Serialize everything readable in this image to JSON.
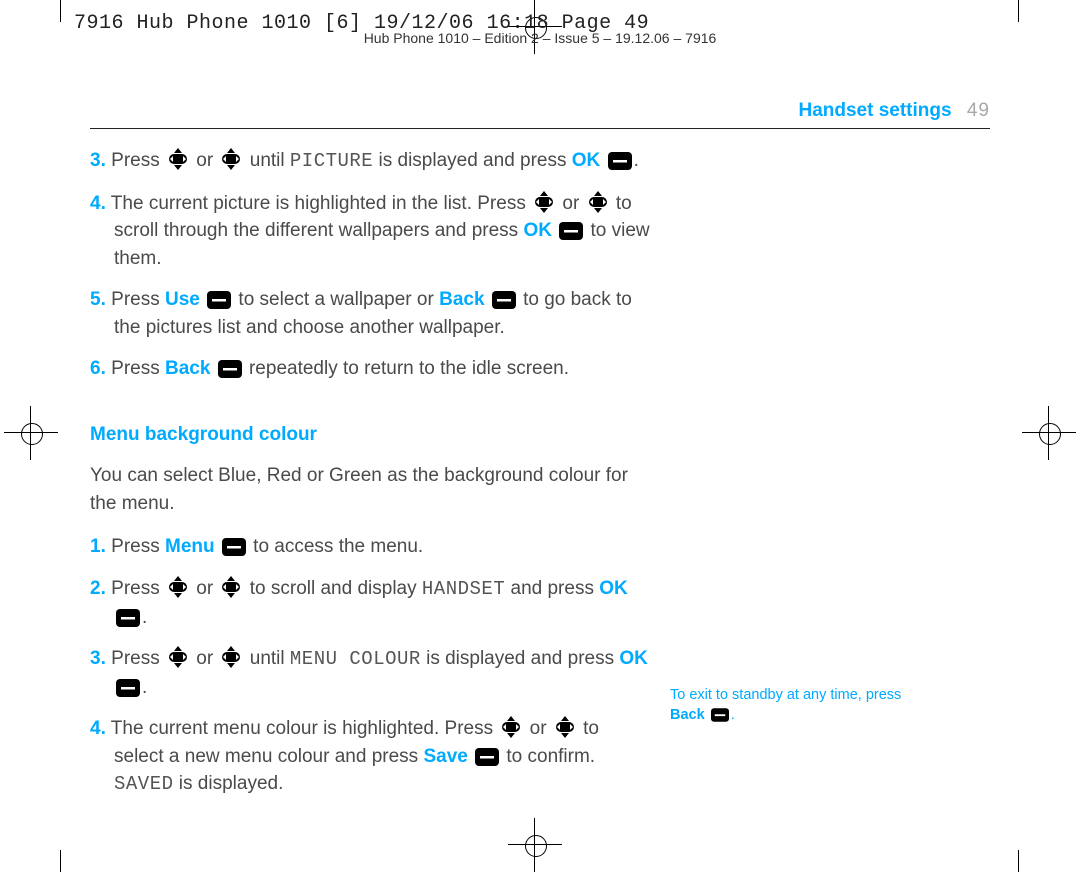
{
  "slug": "7916 Hub Phone 1010 [6]  19/12/06  16:18  Page 49",
  "footer": "Hub Phone 1010 – Edition 2 – Issue 5 – 19.12.06 – 7916",
  "runningHead": {
    "title": "Handset settings",
    "pageNum": "49"
  },
  "steps3": {
    "n": "3.",
    "a": "Press ",
    "b": " or ",
    "c": " until ",
    "disp": "PICTURE",
    "d": " is displayed and press ",
    "ok": "OK",
    "e": "."
  },
  "steps4": {
    "n": "4.",
    "a": "The current picture is highlighted in the list. Press ",
    "b": " or ",
    "c": " to scroll through the different wallpapers and press ",
    "ok": "OK",
    "d": " to view them."
  },
  "steps5": {
    "n": "5.",
    "a": "Press ",
    "use": "Use",
    "b": " to select a wallpaper or ",
    "back": "Back",
    "c": " to go back to the pictures list and choose another wallpaper."
  },
  "steps6": {
    "n": "6.",
    "a": "Press ",
    "back": "Back",
    "b": " repeatedly to return to the idle screen."
  },
  "section2": {
    "heading": "Menu background colour",
    "intro": "You can select Blue, Red or Green as the background colour for the menu."
  },
  "m1": {
    "n": "1.",
    "a": "Press ",
    "menu": "Menu",
    "b": " to access the menu."
  },
  "m2": {
    "n": "2.",
    "a": "Press ",
    "b": " or ",
    "c": " to scroll and display ",
    "disp": "HANDSET",
    "d": " and press ",
    "ok": "OK",
    "e": "."
  },
  "m3": {
    "n": "3.",
    "a": "Press ",
    "b": " or ",
    "c": " until ",
    "disp": "MENU COLOUR",
    "d": " is displayed and press ",
    "ok": "OK",
    "e": "."
  },
  "m4": {
    "n": "4.",
    "a": "The current menu colour is highlighted. Press ",
    "b": " or ",
    "c": " to select a new menu colour and press ",
    "save": "Save",
    "d": " to confirm. ",
    "disp": "SAVED",
    "e": " is displayed."
  },
  "aside": {
    "line1": "To exit to standby at any time, press",
    "back": "Back",
    "tail": "."
  }
}
